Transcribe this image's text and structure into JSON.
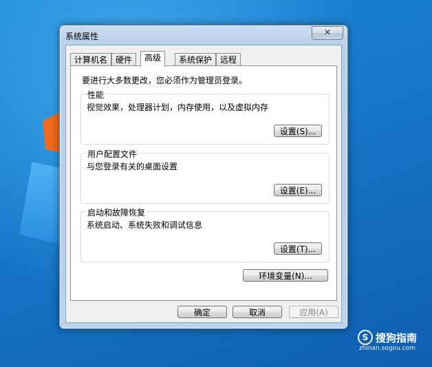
{
  "window": {
    "title": "系统属性",
    "close_label": "✕"
  },
  "tabs": [
    {
      "label": "计算机名"
    },
    {
      "label": "硬件"
    },
    {
      "label": "高级"
    },
    {
      "label": "系统保护"
    },
    {
      "label": "远程"
    }
  ],
  "active_tab": "高级",
  "advanced": {
    "admin_note": "要进行大多数更改，您必须作为管理员登录。",
    "performance": {
      "title": "性能",
      "description": "视觉效果，处理器计划，内存使用，以及虚拟内存",
      "button": "设置(S)..."
    },
    "user_profiles": {
      "title": "用户配置文件",
      "description": "与您登录有关的桌面设置",
      "button": "设置(E)..."
    },
    "startup_recovery": {
      "title": "启动和故障恢复",
      "description": "系统启动、系统失败和调试信息",
      "button": "设置(T)..."
    },
    "env_button": "环境变量(N)..."
  },
  "footer": {
    "ok": "确定",
    "cancel": "取消",
    "apply": "应用(A)"
  },
  "watermark": {
    "brand": "搜狗指南",
    "url": "zhinan.sogou.com"
  }
}
